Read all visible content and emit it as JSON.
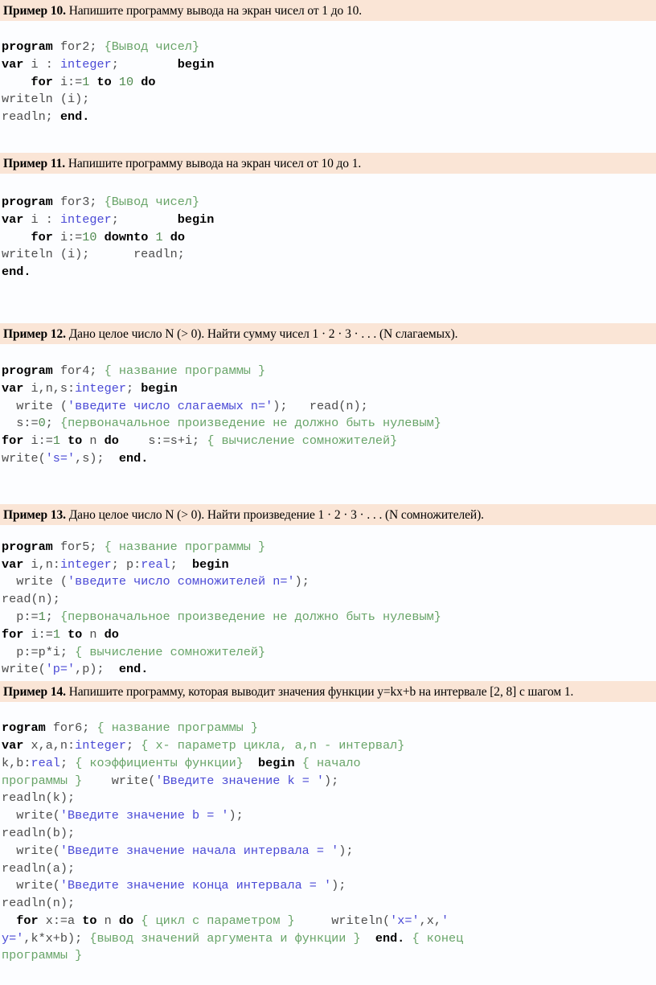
{
  "document": {
    "language": "ru",
    "colors": {
      "band_background": "#fae5d6",
      "page_background": "#fcfdff",
      "keyword": "#000000",
      "identifier": "#4d4d4d",
      "type": "#4a4ad6",
      "string": "#4a4ad6",
      "comment": "#68a468",
      "number": "#4f8a4f"
    }
  },
  "examples": [
    {
      "label": "Пример 10.",
      "task": "Напишите программу вывода на экран чисел от 1 до 10.",
      "code_lines": [
        "program for2; {Вывод чисел}",
        "var i : integer;        begin",
        "    for i:=1 to 10 do",
        "writeln (i);",
        "readln; end."
      ]
    },
    {
      "label": "Пример 11.",
      "task": "Напишите программу вывода на экран чисел от 10 до 1.",
      "code_lines": [
        "program for3; {Вывод чисел}",
        "var i : integer;        begin",
        "    for i:=10 downto 1 do",
        "writeln (i);      readln;",
        "end."
      ]
    },
    {
      "label": "Пример 12.",
      "task": "Дано целое число N (> 0). Найти сумму чисел 1 · 2 · 3 · . . . (N слагаемых).",
      "code_lines": [
        "program for4; { название программы }",
        "var i,n,s:integer; begin",
        "  write ('введите число слагаемых n=');   read(n);",
        "  s:=0; {первоначальное произведение не должно быть нулевым}",
        "for i:=1 to n do    s:=s+i; { вычисление сомножителей}",
        "write('s=',s);  end."
      ]
    },
    {
      "label": "Пример 13.",
      "task": "Дано целое число N (> 0). Найти произведение 1 · 2 · 3 · . . . (N сомножителей).",
      "code_lines": [
        "program for5; { название программы }",
        "var i,n:integer; p:real;  begin",
        "  write ('введите число сомножителей n=');",
        "read(n);",
        "  p:=1; {первоначальное произведение не должно быть нулевым}",
        "for i:=1 to n do",
        "  p:=p*i; { вычисление сомножителей}",
        "write('p=',p);  end."
      ]
    },
    {
      "label": "Пример 14.",
      "task": "Напишите программу, которая выводит значения функции y=kx+b на интервале [2, 8] с шагом 1.",
      "code_lines": [
        "rogram for6; { название программы }",
        "var x,a,n:integer; { x- параметр цикла, a,n - интервал}",
        "k,b:real; { коэффициенты функции}  begin { начало",
        "программы }    write('Введите значение k = ');",
        "readln(k);",
        "  write('Введите значение b = ');",
        "readln(b);",
        "  write('Введите значение начала интервала = ');",
        "readln(a);",
        "  write('Введите значение конца интервала = ');",
        "readln(n);",
        "  for x:=a to n do { цикл с параметром }     writeln('x=',x,'",
        "y=',k*x+b); {вывод значений аргумента и функции }  end. { конец",
        "программы }"
      ]
    }
  ]
}
